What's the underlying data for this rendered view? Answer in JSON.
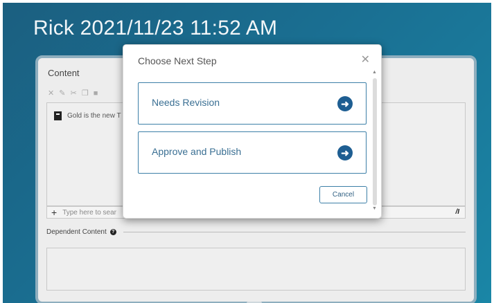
{
  "page": {
    "title": "Rick 2021/11/23 11:52 AM"
  },
  "panel": {
    "content_label": "Content",
    "toolbar_icons": [
      "close-icon",
      "pencil-icon",
      "cut-icon",
      "copy-icon",
      "paste-icon"
    ],
    "editor_text": "Gold is the new T",
    "search_placeholder": "Type here to sear",
    "dependent_label": "Dependent Content"
  },
  "modal": {
    "title": "Choose Next Step",
    "options": [
      {
        "label": "Needs Revision"
      },
      {
        "label": "Approve and Publish"
      }
    ],
    "cancel_label": "Cancel"
  },
  "colors": {
    "background": "#1a6f92",
    "accent": "#1e5e92",
    "option_border": "#3c7fa7"
  }
}
